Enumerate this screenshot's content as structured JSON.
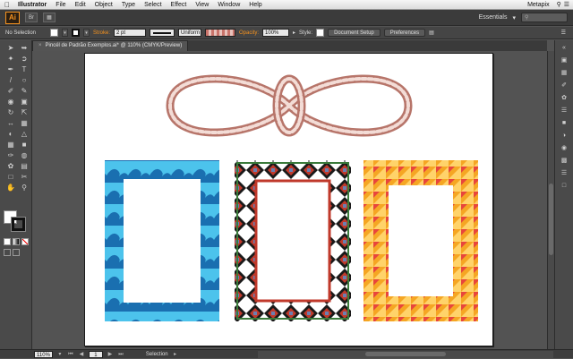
{
  "menubar": {
    "app": "Illustrator",
    "items": [
      "File",
      "Edit",
      "Object",
      "Type",
      "Select",
      "Effect",
      "View",
      "Window",
      "Help"
    ],
    "user": "Metapix"
  },
  "appbar": {
    "logo": "Ai",
    "workspace": "Essentials",
    "search_placeholder": ""
  },
  "control": {
    "selection": "No Selection",
    "stroke_label": "Stroke:",
    "stroke_weight": "2 pt",
    "profile": "Uniform",
    "opacity_label": "Opacity:",
    "opacity": "100%",
    "style_label": "Style:",
    "doc_setup": "Document Setup",
    "preferences": "Preferences"
  },
  "tab": {
    "title": "Pincél de Padrão Exemplos.ai* @ 110% (CMYK/Preview)",
    "close": "×"
  },
  "status": {
    "zoom": "110%",
    "page": "1",
    "tool": "Selection"
  },
  "colors": {
    "rope": "#b7756a",
    "wave_dark": "#1a6fb0",
    "wave_light": "#4cc3ec",
    "tri_red": "#e8453c",
    "tri_orange": "#f5a623",
    "tri_yellow": "#ffd36a",
    "tribal_red": "#c0392b",
    "tribal_blue": "#6b7fb0",
    "tribal_black": "#1a1a1a",
    "tribal_green": "#3a7a3a"
  }
}
